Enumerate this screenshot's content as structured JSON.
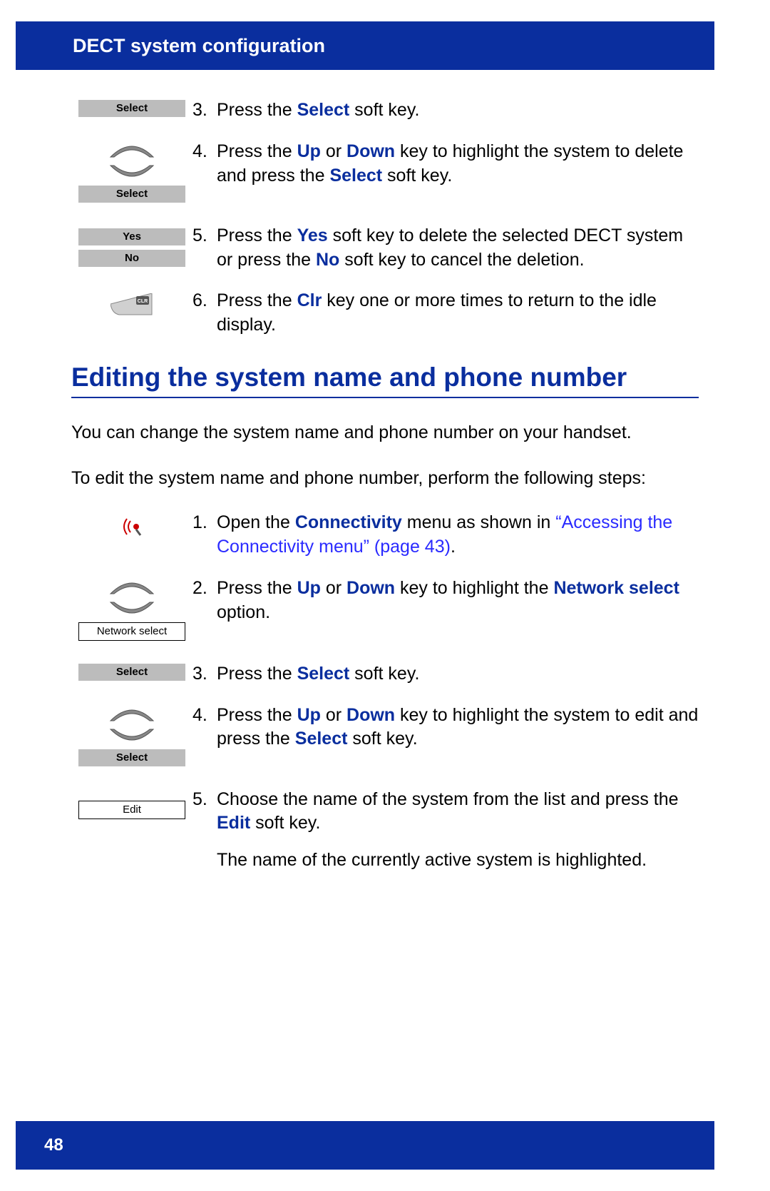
{
  "header": {
    "title": "DECT system configuration"
  },
  "footer": {
    "page_number": "48"
  },
  "labels": {
    "select": "Select",
    "yes": "Yes",
    "no": "No",
    "network_select": "Network select",
    "edit": "Edit"
  },
  "topSteps": {
    "s3": {
      "n": "3.",
      "pre": "Press the ",
      "k1": "Select",
      "post": " soft key."
    },
    "s4": {
      "n": "4.",
      "pre": "Press the ",
      "k1": "Up",
      "mid1": " or ",
      "k2": "Down",
      "mid2": " key to highlight the system to delete and press the ",
      "k3": "Select",
      "post": " soft key."
    },
    "s5": {
      "n": "5.",
      "pre": "Press the ",
      "k1": "Yes",
      "mid1": " soft key to delete the selected DECT system or press the ",
      "k2": "No",
      "post": " soft key to cancel the deletion."
    },
    "s6": {
      "n": "6.",
      "pre": "Press the ",
      "k1": "Clr",
      "post": " key one or more times to return to the idle display."
    }
  },
  "heading": "Editing the system name and phone number",
  "intro1": "You can change the system name and phone number on your handset.",
  "intro2": "To edit the system name and phone number, perform the following steps:",
  "bottomSteps": {
    "s1": {
      "n": "1.",
      "pre": "Open the ",
      "k1": "Connectivity",
      "mid": " menu as shown in ",
      "link": "“Accessing the Connectivity menu” (page 43)",
      "post": "."
    },
    "s2": {
      "n": "2.",
      "pre": "Press the ",
      "k1": "Up",
      "mid1": " or ",
      "k2": "Down",
      "mid2": " key to highlight the ",
      "k3": "Network select",
      "post": " option."
    },
    "s3": {
      "n": "3.",
      "pre": "Press the ",
      "k1": "Select",
      "post": " soft key."
    },
    "s4": {
      "n": "4.",
      "pre": "Press the ",
      "k1": "Up",
      "mid1": " or ",
      "k2": "Down",
      "mid2": " key to highlight the system to edit and press the ",
      "k3": "Select",
      "post": " soft key."
    },
    "s5": {
      "n": "5.",
      "pre": "Choose the name of the system from the list and press the ",
      "k1": "Edit",
      "post": " soft key.",
      "extra": "The name of the currently active system is highlighted."
    }
  }
}
